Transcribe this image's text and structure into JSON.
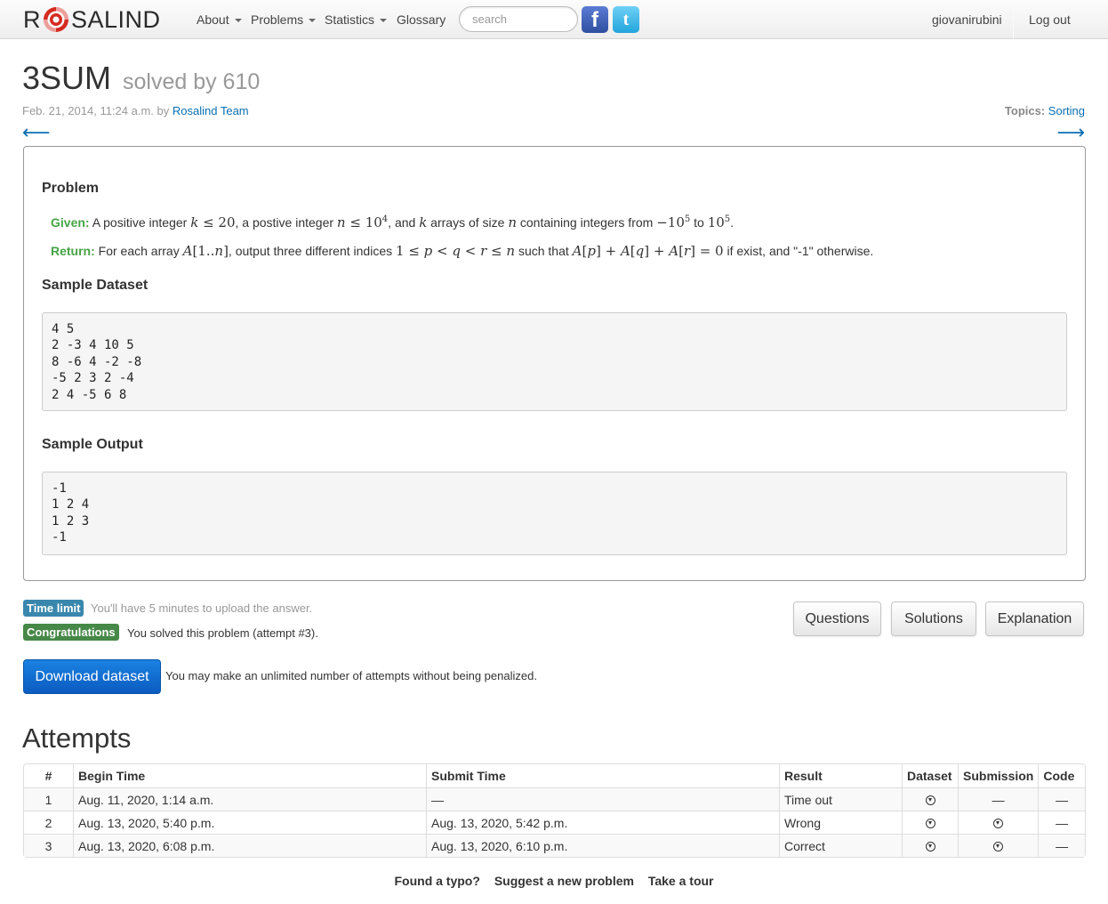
{
  "nav": {
    "brand_left": "R",
    "brand_right": "SALIND",
    "about": "About",
    "problems": "Problems",
    "statistics": "Statistics",
    "glossary": "Glossary",
    "search_placeholder": "search",
    "facebook": "f",
    "twitter": "t",
    "user": "giovanirubini",
    "logout": "Log out"
  },
  "header": {
    "title": "3SUM",
    "solved": "solved by 610",
    "date": "Feb. 21, 2014, 11:24 a.m. by",
    "author": "Rosalind Team",
    "topics_label": "Topics:",
    "topic": "Sorting",
    "prev_arrow": "⟵",
    "next_arrow": "⟶"
  },
  "problem": {
    "heading": "Problem",
    "given_label": "Given:",
    "return_label": "Return:",
    "sample_dataset_heading": "Sample Dataset",
    "sample_dataset": "4 5\n2 -3 4 10 5\n8 -6 4 -2 -8\n-5 2 3 2 -4\n2 4 -5 6 8",
    "sample_output_heading": "Sample Output",
    "sample_output": "-1\n1 2 4\n1 2 3\n-1"
  },
  "status": {
    "time_limit_badge": "Time limit",
    "time_limit_text": "You'll have 5 minutes to upload the answer.",
    "congrats_badge": "Congratulations",
    "congrats_text": "You solved this problem (attempt #3).",
    "questions": "Questions",
    "solutions": "Solutions",
    "explanation": "Explanation",
    "download": "Download dataset",
    "download_note": "You may make an unlimited number of attempts without being penalized."
  },
  "attempts": {
    "heading": "Attempts",
    "columns": [
      "#",
      "Begin Time",
      "Submit Time",
      "Result",
      "Dataset",
      "Submission",
      "Code"
    ],
    "rows": [
      {
        "num": "1",
        "begin": "Aug. 11, 2020, 1:14 a.m.",
        "submit": "—",
        "result": "Time out",
        "submission": "—",
        "code": "—"
      },
      {
        "num": "2",
        "begin": "Aug. 13, 2020, 5:40 p.m.",
        "submit": "Aug. 13, 2020, 5:42 p.m.",
        "result": "Wrong",
        "code": "—"
      },
      {
        "num": "3",
        "begin": "Aug. 13, 2020, 6:08 p.m.",
        "submit": "Aug. 13, 2020, 6:10 p.m.",
        "result": "Correct",
        "code": "—"
      }
    ]
  },
  "footer": {
    "typo": "Found a typo?",
    "suggest": "Suggest a new problem",
    "tour": "Take a tour"
  }
}
